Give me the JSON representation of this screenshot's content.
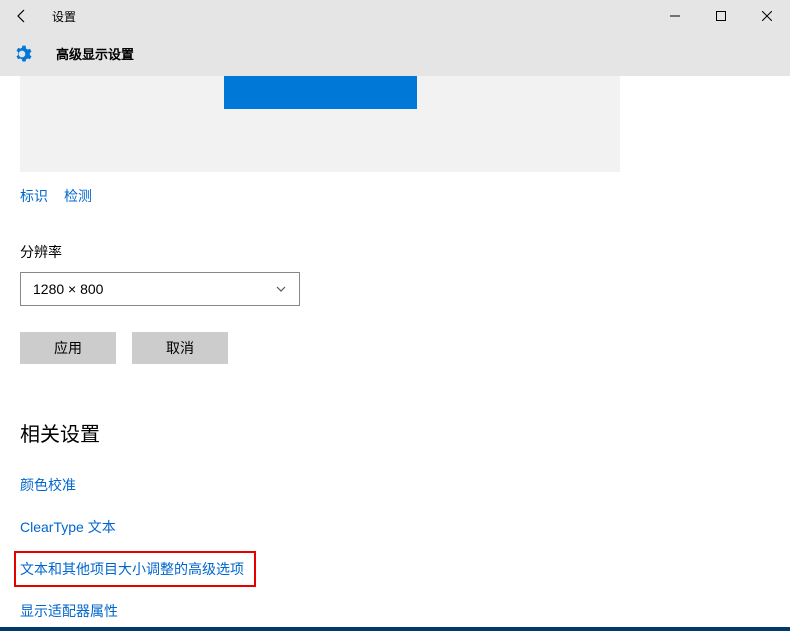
{
  "titleBar": {
    "title": "设置"
  },
  "header": {
    "title": "高级显示设置"
  },
  "links": {
    "identify": "标识",
    "detect": "检测"
  },
  "resolution": {
    "label": "分辨率",
    "value": "1280 × 800"
  },
  "buttons": {
    "apply": "应用",
    "cancel": "取消"
  },
  "related": {
    "heading": "相关设置",
    "items": [
      "颜色校准",
      "ClearType 文本",
      "文本和其他项目大小调整的高级选项",
      "显示适配器属性"
    ]
  }
}
